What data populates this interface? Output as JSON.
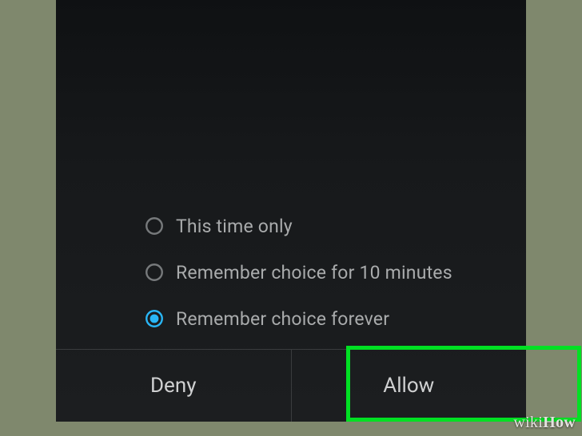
{
  "dialog": {
    "options": [
      {
        "label": "This time only",
        "selected": false
      },
      {
        "label": "Remember choice for 10 minutes",
        "selected": false
      },
      {
        "label": "Remember choice forever",
        "selected": true
      }
    ],
    "deny_label": "Deny",
    "allow_label": "Allow"
  },
  "colors": {
    "accent": "#29b6f6",
    "radio_unselected": "#777a7c",
    "highlight": "#00e023"
  },
  "watermark": {
    "part1": "wiki",
    "part2": "How"
  }
}
